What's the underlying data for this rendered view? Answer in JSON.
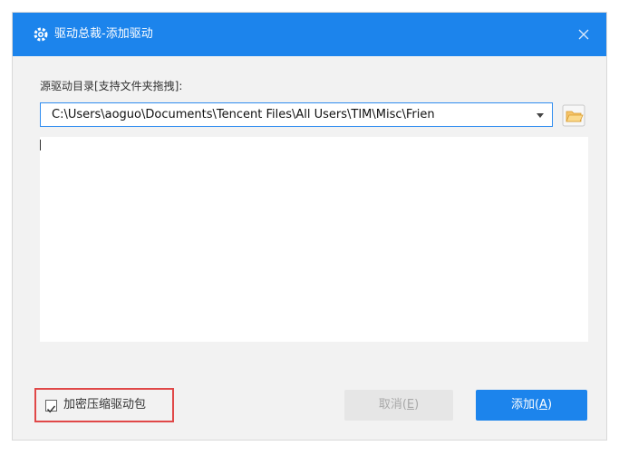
{
  "window": {
    "title": "驱动总裁-添加驱动",
    "icon": "gear-icon",
    "close_icon": "close-icon",
    "titlebar_color": "#1c84ec"
  },
  "source": {
    "label": "源驱动目录[支持文件夹拖拽]:",
    "path_value": "C:\\Users\\aoguo\\Documents\\Tencent Files\\All Users\\TIM\\Misc\\Frien",
    "dropdown_icon": "chevron-down-icon",
    "browse_icon": "folder-icon"
  },
  "options": {
    "encrypt_label": "加密压缩驱动包",
    "encrypt_checked": true
  },
  "buttons": {
    "cancel_label": "取消(",
    "cancel_hotkey": "E",
    "cancel_suffix": ")",
    "add_label": "添加(",
    "add_hotkey": "A",
    "add_suffix": ")",
    "accent": "#1c84ec",
    "highlight": "#e04848"
  }
}
